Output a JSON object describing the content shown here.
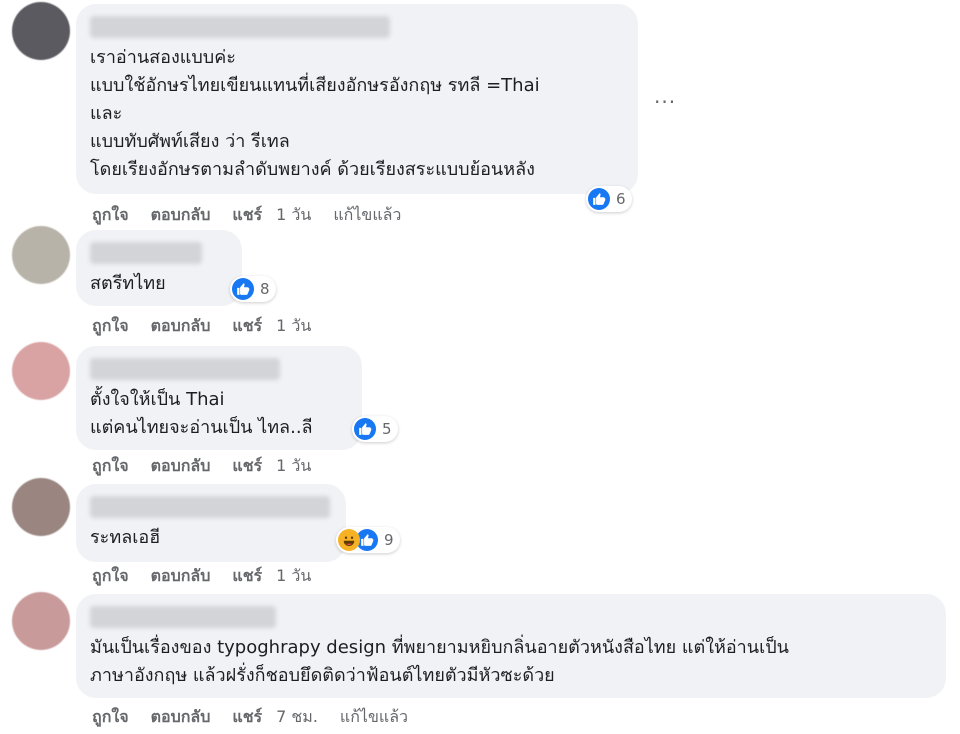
{
  "comments": [
    {
      "lines": [
        "เราอ่านสองแบบค่ะ",
        "แบบใช้อักษรไทยเขียนแทนที่เสียงอักษรอังกฤษ รทลี =Thai",
        "และ",
        "แบบทับศัพท์เสียง ว่า รีเทล",
        "โดยเรียงอักษรตามลำดับพยางค์ ด้วยเรียงสระแบบย้อนหลัง"
      ],
      "reaction_count": "6",
      "like": "ถูกใจ",
      "reply": "ตอบกลับ",
      "share": "แชร์",
      "time": "1 วัน",
      "edited": "แก้ไขแล้ว",
      "more": "···",
      "avatar_color": "#5a5a60"
    },
    {
      "lines": [
        "สตรีทไทย"
      ],
      "reaction_count": "8",
      "like": "ถูกใจ",
      "reply": "ตอบกลับ",
      "share": "แชร์",
      "time": "1 วัน",
      "avatar_color": "#b8b3a8"
    },
    {
      "lines": [
        "ตั้งใจให้เป็น Thai",
        "แต่คนไทยจะอ่านเป็น ไทล..ลี"
      ],
      "reaction_count": "5",
      "like": "ถูกใจ",
      "reply": "ตอบกลับ",
      "share": "แชร์",
      "time": "1 วัน",
      "avatar_color": "#d9a3a3"
    },
    {
      "lines": [
        "ระทลเอฮี"
      ],
      "reaction_count": "9",
      "like": "ถูกใจ",
      "reply": "ตอบกลับ",
      "share": "แชร์",
      "time": "1 วัน",
      "avatar_color": "#9a8580"
    },
    {
      "lines": [
        "มันเป็นเรื่องของ typoghrapy design ที่พยายามหยิบกลิ่นอายตัวหนังสือไทย แต่ให้อ่านเป็น",
        "ภาษาอังกฤษ แล้วฝรั่งก็ชอบยึดติดว่าฟ้อนต์ไทยตัวมีหัวซะด้วย"
      ],
      "like": "ถูกใจ",
      "reply": "ตอบกลับ",
      "share": "แชร์",
      "time": "7 ชม.",
      "edited": "แก้ไขแล้ว",
      "avatar_color": "#c99a9a"
    }
  ],
  "icons": {
    "like": "thumbs-up-icon",
    "haha": "laughing-face-icon",
    "more": "more-options-icon"
  },
  "colors": {
    "like_blue": "#1877f2",
    "bubble_bg": "#f0f2f5",
    "meta_gray": "#65676b"
  }
}
